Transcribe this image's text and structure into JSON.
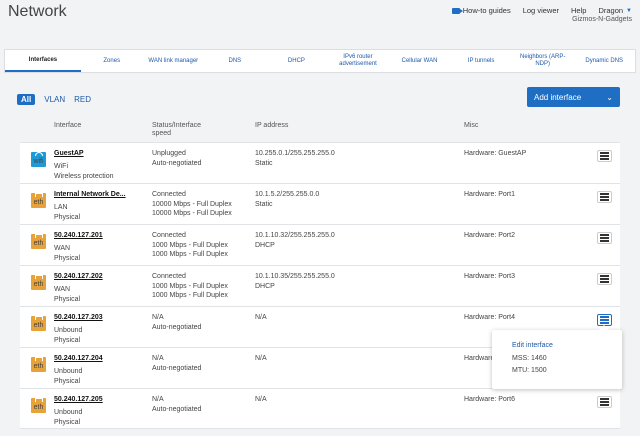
{
  "header": {
    "title": "Network",
    "links": {
      "how_to": "How-to guides",
      "log_viewer": "Log viewer",
      "help": "Help",
      "user": "Dragon"
    },
    "org": "Gizmos-N-Gadgets"
  },
  "tabs": [
    {
      "label": "Interfaces",
      "active": true
    },
    {
      "label": "Zones"
    },
    {
      "label": "WAN link manager"
    },
    {
      "label": "DNS"
    },
    {
      "label": "DHCP"
    },
    {
      "label": "IPv6 router advertisement"
    },
    {
      "label": "Cellular WAN"
    },
    {
      "label": "IP tunnels"
    },
    {
      "label": "Neighbors (ARP-NDP)"
    },
    {
      "label": "Dynamic DNS"
    }
  ],
  "filters": [
    "All",
    "VLAN",
    "RED"
  ],
  "add_button": "Add interface",
  "columns": {
    "interface": "Interface",
    "status": "Status/Interface speed",
    "ip": "IP address",
    "misc": "Misc"
  },
  "rows": [
    {
      "icon": "wifi",
      "icon_label": "wifi",
      "name": "GuestAP",
      "type": "WiFi",
      "sub": "Wireless protection",
      "status": [
        "Unplugged",
        "Auto-negotiated",
        ""
      ],
      "ip": [
        "10.255.0.1/255.255.255.0",
        "Static"
      ],
      "misc": "Hardware:  GuestAP"
    },
    {
      "icon": "eth",
      "icon_label": "eth",
      "name": "Internal Network De...",
      "type": "LAN",
      "sub": "Physical",
      "status": [
        "Connected",
        "10000 Mbps - Full Duplex",
        "10000 Mbps - Full Duplex"
      ],
      "ip": [
        "10.1.5.2/255.255.0.0",
        "Static"
      ],
      "misc": "Hardware:  Port1"
    },
    {
      "icon": "eth",
      "icon_label": "eth",
      "name": "50.240.127.201",
      "type": "WAN",
      "sub": "Physical",
      "status": [
        "Connected",
        "1000 Mbps - Full Duplex",
        "1000 Mbps - Full Duplex"
      ],
      "ip": [
        "10.1.10.32/255.255.255.0",
        "DHCP"
      ],
      "misc": "Hardware:  Port2"
    },
    {
      "icon": "eth",
      "icon_label": "eth",
      "name": "50.240.127.202",
      "type": "WAN",
      "sub": "Physical",
      "status": [
        "Connected",
        "1000 Mbps - Full Duplex",
        "1000 Mbps - Full Duplex"
      ],
      "ip": [
        "10.1.10.35/255.255.255.0",
        "DHCP"
      ],
      "misc": "Hardware:  Port3"
    },
    {
      "icon": "eth",
      "icon_label": "eth",
      "name": "50.240.127.203",
      "type": "Unbound",
      "sub": "Physical",
      "status": [
        "N/A",
        "Auto-negotiated",
        ""
      ],
      "ip": [
        "N/A",
        ""
      ],
      "misc": "Hardware:  Port4"
    },
    {
      "icon": "eth",
      "icon_label": "eth",
      "name": "50.240.127.204",
      "type": "Unbound",
      "sub": "Physical",
      "status": [
        "N/A",
        "Auto-negotiated",
        ""
      ],
      "ip": [
        "N/A",
        ""
      ],
      "misc": "Hardware"
    },
    {
      "icon": "eth",
      "icon_label": "eth",
      "name": "50.240.127.205",
      "type": "Unbound",
      "sub": "Physical",
      "status": [
        "N/A",
        "Auto-negotiated",
        ""
      ],
      "ip": [
        "N/A",
        ""
      ],
      "misc": "Hardware:  Port6"
    }
  ],
  "popup": {
    "edit": "Edit interface",
    "mss": "MSS:  1460",
    "mtu": "MTU:  1500"
  },
  "colors": {
    "accent": "#1e6fc4",
    "wifi": "#1e9ad6",
    "eth": "#e7a23a"
  }
}
